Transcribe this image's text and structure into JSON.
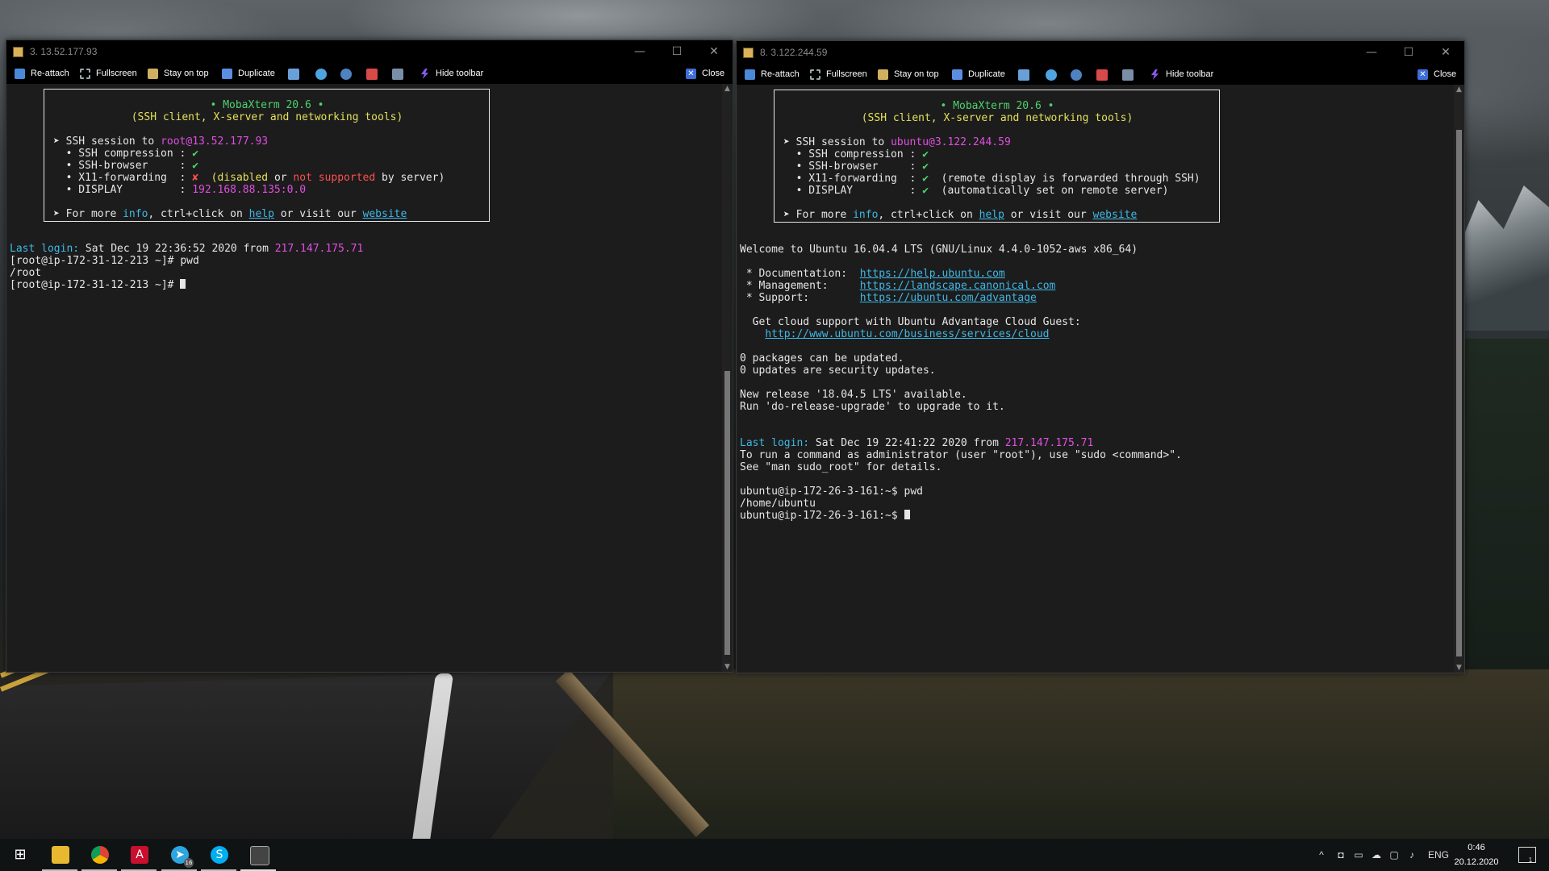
{
  "windows": {
    "left": {
      "title": "3. 13.52.177.93",
      "controls": {
        "minimize": "—",
        "maximize": "☐",
        "close": "✕"
      },
      "toolbar": {
        "reattach": "Re-attach",
        "fullscreen": "Fullscreen",
        "stay_on_top": "Stay on top",
        "duplicate": "Duplicate",
        "hide_toolbar": "Hide toolbar",
        "close": "Close"
      },
      "banner": {
        "title": "• MobaXterm 20.6 •",
        "subtitle": "(SSH client, X-server and networking tools)",
        "session_prefix": "➤ SSH session to ",
        "user": "root",
        "host": "@13.52.177.93",
        "compression": "  • SSH compression : ",
        "compression_val": "✔",
        "browser": "  • SSH-browser     : ",
        "browser_val": "✔",
        "x11": "  • X11-forwarding  : ",
        "x11_val": "✘",
        "x11_note_a": "  (disabled ",
        "x11_note_b": "or ",
        "x11_note_c": "not supported ",
        "x11_note_d": "by server)",
        "display": "  • DISPLAY         : ",
        "display_val": "192.168.88.135:0.0",
        "more_a": "➤ For more ",
        "more_info": "info",
        "more_b": ", ctrl+click on ",
        "more_help": "help",
        "more_c": " or visit our ",
        "more_site": "website"
      },
      "last_login_label": "Last login:",
      "last_login_text": " Sat Dec 19 22:36:52 2020 from ",
      "last_login_ip": "217.147.175.71",
      "lines": [
        "[root@ip-172-31-12-213 ~]# pwd",
        "/root",
        "[root@ip-172-31-12-213 ~]# "
      ]
    },
    "right": {
      "title": "8. 3.122.244.59",
      "controls": {
        "minimize": "—",
        "maximize": "☐",
        "close": "✕"
      },
      "toolbar": {
        "reattach": "Re-attach",
        "fullscreen": "Fullscreen",
        "stay_on_top": "Stay on top",
        "duplicate": "Duplicate",
        "hide_toolbar": "Hide toolbar",
        "close": "Close"
      },
      "banner": {
        "title": "• MobaXterm 20.6 •",
        "subtitle": "(SSH client, X-server and networking tools)",
        "session_prefix": "➤ SSH session to ",
        "user": "ubuntu",
        "host": "@3.122.244.59",
        "compression": "  • SSH compression : ",
        "compression_val": "✔",
        "browser": "  • SSH-browser     : ",
        "browser_val": "✔",
        "x11": "  • X11-forwarding  : ",
        "x11_val": "✔",
        "x11_note": "  (remote display is forwarded through SSH)",
        "display": "  • DISPLAY         : ",
        "display_val": "✔",
        "display_note": "  (automatically set on remote server)",
        "more_a": "➤ For more ",
        "more_info": "info",
        "more_b": ", ctrl+click on ",
        "more_help": "help",
        "more_c": " or visit our ",
        "more_site": "website"
      },
      "welcome": "Welcome to Ubuntu 16.04.4 LTS (GNU/Linux 4.4.0-1052-aws x86_64)",
      "doc_label": " * Documentation:  ",
      "doc_url": "https://help.ubuntu.com",
      "mgmt_label": " * Management:     ",
      "mgmt_url": "https://landscape.canonical.com",
      "support_label": " * Support:        ",
      "support_url": "https://ubuntu.com/advantage",
      "cloud_line": "  Get cloud support with Ubuntu Advantage Cloud Guest:",
      "cloud_url": "http://www.ubuntu.com/business/services/cloud",
      "pkg_line1": "0 packages can be updated.",
      "pkg_line2": "0 updates are security updates.",
      "release_line1": "New release '18.04.5 LTS' available.",
      "release_line2": "Run 'do-release-upgrade' to upgrade to it.",
      "last_login_label": "Last login:",
      "last_login_text": " Sat Dec 19 22:41:22 2020 from ",
      "last_login_ip": "217.147.175.71",
      "sudo_line1": "To run a command as administrator (user \"root\"), use \"sudo <command>\".",
      "sudo_line2": "See \"man sudo_root\" for details.",
      "lines": [
        "ubuntu@ip-172-26-3-161:~$ pwd",
        "/home/ubuntu",
        "ubuntu@ip-172-26-3-161:~$ "
      ]
    }
  },
  "taskbar": {
    "apps": [
      "windows-start",
      "file-explorer",
      "chrome",
      "acrobat",
      "telegram",
      "skype",
      "mobaxterm"
    ],
    "telegram_badge": "16",
    "tray": {
      "lang": "ENG",
      "time": "0:46",
      "date": "20.12.2020",
      "notif_count": "1"
    }
  },
  "colors": {
    "terminal_bg": "#1c1c1c",
    "green": "#4fd26e",
    "yellow": "#e2e05a",
    "magenta": "#e04fe0",
    "cyan": "#3fb8e6",
    "red": "#ff4f4f"
  }
}
